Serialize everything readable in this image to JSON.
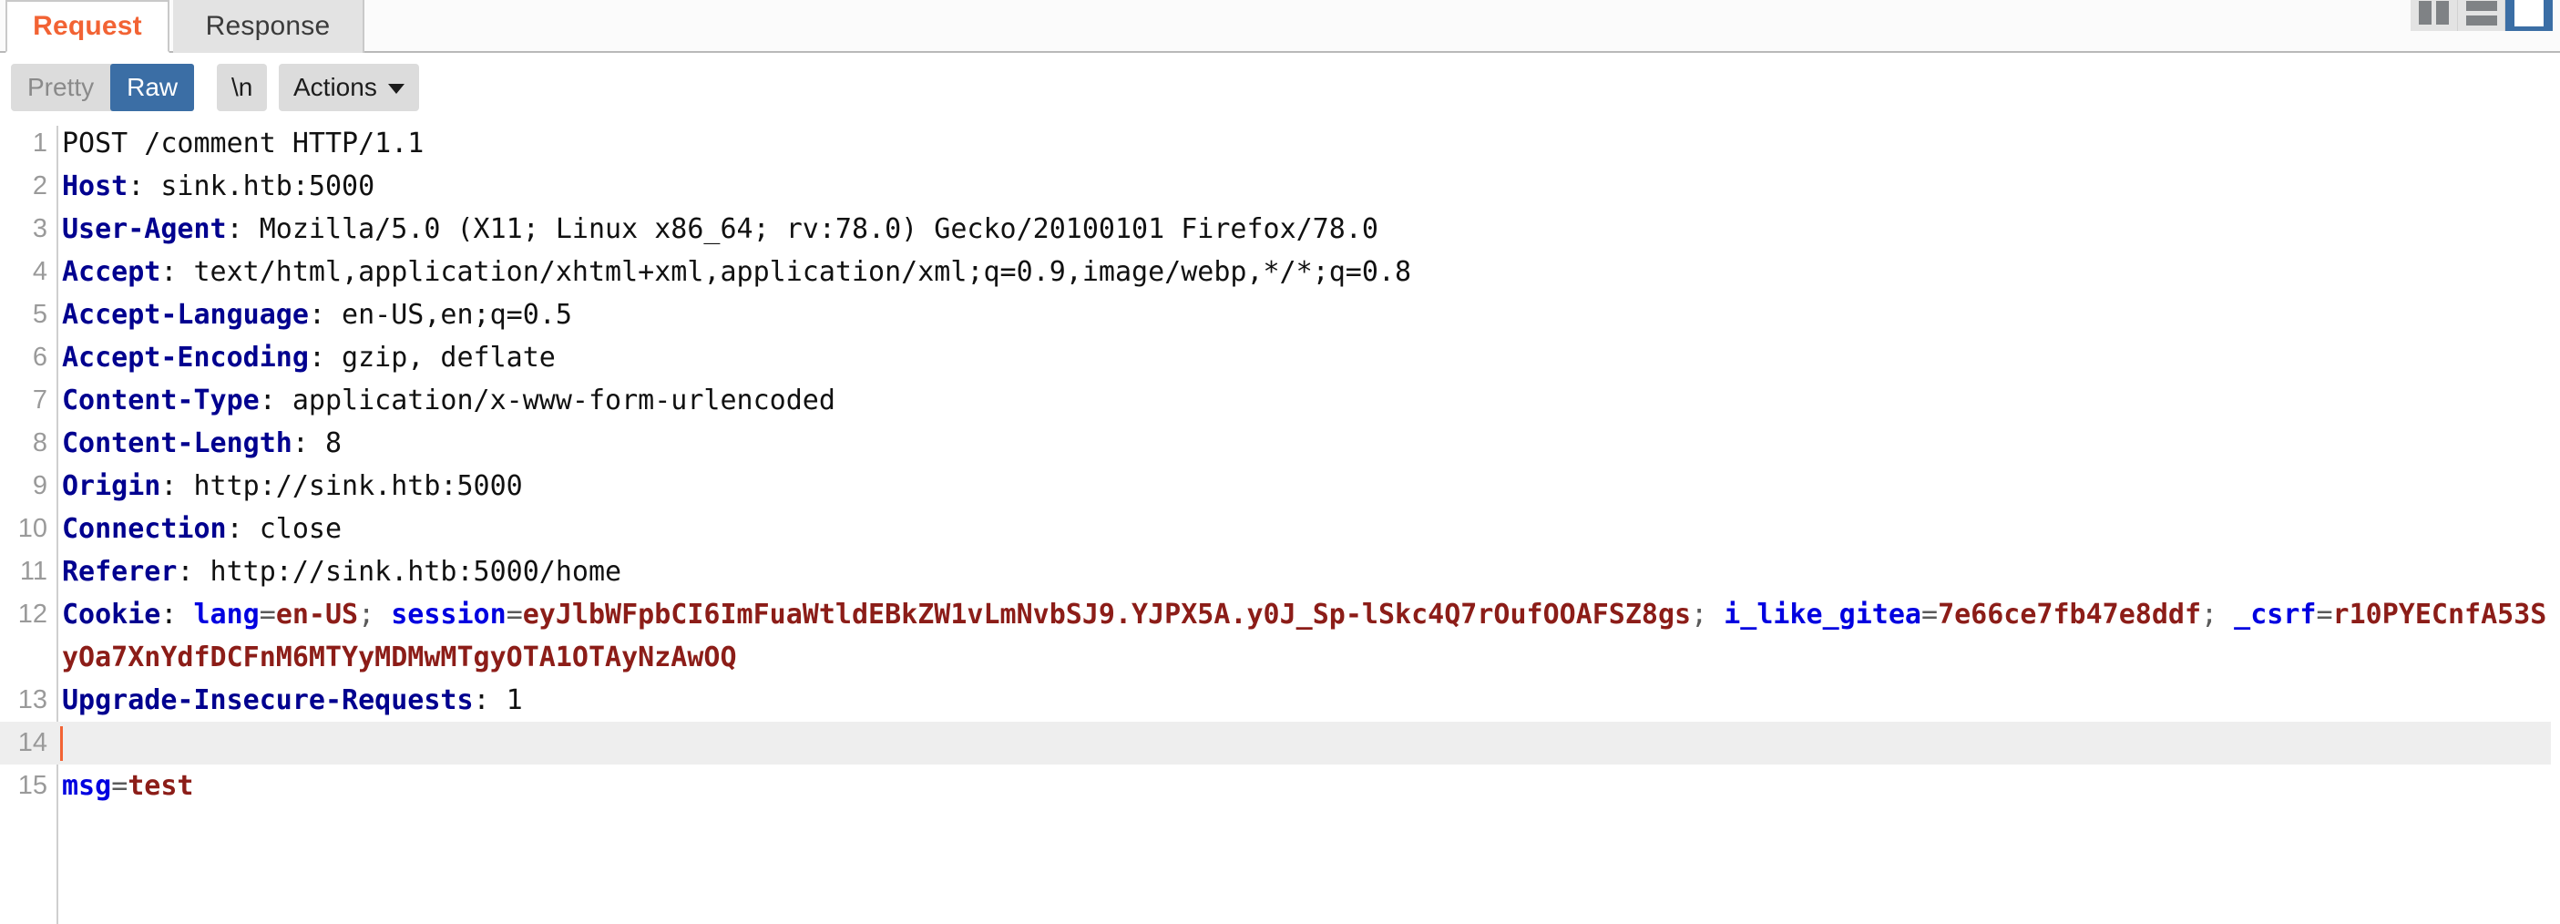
{
  "window": {
    "layout_buttons": [
      {
        "name": "split-vertical",
        "selected": false
      },
      {
        "name": "split-horizontal",
        "selected": false
      },
      {
        "name": "single-pane",
        "selected": true
      }
    ]
  },
  "tabs": [
    {
      "label": "Request",
      "active": true,
      "color": "#f26334"
    },
    {
      "label": "Response",
      "active": false,
      "color": "#3b3b3b"
    }
  ],
  "toolbar": {
    "view_modes": [
      {
        "label": "Pretty",
        "selected": false
      },
      {
        "label": "Raw",
        "selected": true
      }
    ],
    "newline_label": "\\n",
    "actions_label": "Actions",
    "accent": "#3b6ea5"
  },
  "editor": {
    "line_numbers": [
      "1",
      "2",
      "3",
      "4",
      "5",
      "6",
      "7",
      "8",
      "9",
      "10",
      "11",
      "12",
      "13",
      "14",
      "15"
    ],
    "highlighted_line": 14,
    "caret_line": 14,
    "lines": [
      {
        "n": "1",
        "tokens": [
          {
            "t": "POST /comment HTTP/1.1",
            "c": "plain"
          }
        ]
      },
      {
        "n": "2",
        "tokens": [
          {
            "t": "Host",
            "c": "hdr"
          },
          {
            "t": ": sink.htb:5000",
            "c": "plain"
          }
        ]
      },
      {
        "n": "3",
        "tokens": [
          {
            "t": "User-Agent",
            "c": "hdr"
          },
          {
            "t": ": Mozilla/5.0 (X11; Linux x86_64; rv:78.0) Gecko/20100101 Firefox/78.0",
            "c": "plain"
          }
        ]
      },
      {
        "n": "4",
        "tokens": [
          {
            "t": "Accept",
            "c": "hdr"
          },
          {
            "t": ": text/html,application/xhtml+xml,application/xml;q=0.9,image/webp,*/*;q=0.8",
            "c": "plain"
          }
        ]
      },
      {
        "n": "5",
        "tokens": [
          {
            "t": "Accept-Language",
            "c": "hdr"
          },
          {
            "t": ": en-US,en;q=0.5",
            "c": "plain"
          }
        ]
      },
      {
        "n": "6",
        "tokens": [
          {
            "t": "Accept-Encoding",
            "c": "hdr"
          },
          {
            "t": ": gzip, deflate",
            "c": "plain"
          }
        ]
      },
      {
        "n": "7",
        "tokens": [
          {
            "t": "Content-Type",
            "c": "hdr"
          },
          {
            "t": ": application/x-www-form-urlencoded",
            "c": "plain"
          }
        ]
      },
      {
        "n": "8",
        "tokens": [
          {
            "t": "Content-Length",
            "c": "hdr"
          },
          {
            "t": ": 8",
            "c": "plain"
          }
        ]
      },
      {
        "n": "9",
        "tokens": [
          {
            "t": "Origin",
            "c": "hdr"
          },
          {
            "t": ": http://sink.htb:5000",
            "c": "plain"
          }
        ]
      },
      {
        "n": "10",
        "tokens": [
          {
            "t": "Connection",
            "c": "hdr"
          },
          {
            "t": ": close",
            "c": "plain"
          }
        ]
      },
      {
        "n": "11",
        "tokens": [
          {
            "t": "Referer",
            "c": "hdr"
          },
          {
            "t": ": http://sink.htb:5000/home",
            "c": "plain"
          }
        ]
      },
      {
        "n": "12",
        "wrapped": true,
        "tokens": [
          {
            "t": "Cookie",
            "c": "hdr"
          },
          {
            "t": ": ",
            "c": "plain"
          },
          {
            "t": "lang",
            "c": "ckey"
          },
          {
            "t": "=",
            "c": "sep"
          },
          {
            "t": "en-US",
            "c": "cval"
          },
          {
            "t": "; ",
            "c": "sep"
          },
          {
            "t": "session",
            "c": "ckey"
          },
          {
            "t": "=",
            "c": "sep"
          },
          {
            "t": "eyJlbWFpbCI6ImFuaWtldEBkZW1vLmNvbSJ9.YJPX5A.y0J_Sp-lSkc4Q7rOufOOAFSZ8gs",
            "c": "cval"
          },
          {
            "t": "; ",
            "c": "sep"
          },
          {
            "t": "i_like_gitea",
            "c": "ckey"
          },
          {
            "t": "=",
            "c": "sep"
          },
          {
            "t": "7e66ce7fb47e8ddf",
            "c": "cval"
          },
          {
            "t": "; ",
            "c": "sep"
          },
          {
            "t": "_csrf",
            "c": "ckey"
          },
          {
            "t": "=",
            "c": "sep"
          },
          {
            "t": "r10PYECnfA53SyOa7XnYdfDCFnM6MTYyMDMwMTgyOTA1OTAyNzAwOQ",
            "c": "cval"
          }
        ]
      },
      {
        "n": "13",
        "tokens": [
          {
            "t": "Upgrade-Insecure-Requests",
            "c": "hdr"
          },
          {
            "t": ": 1",
            "c": "plain"
          }
        ]
      },
      {
        "n": "14",
        "tokens": []
      },
      {
        "n": "15",
        "tokens": [
          {
            "t": "msg",
            "c": "ckey"
          },
          {
            "t": "=",
            "c": "sep"
          },
          {
            "t": "test",
            "c": "cval"
          }
        ]
      }
    ]
  }
}
